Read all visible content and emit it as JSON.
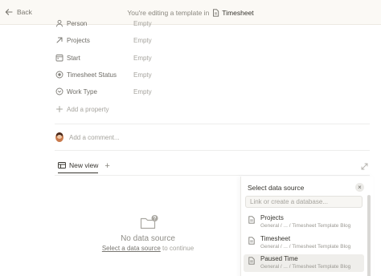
{
  "banner": {
    "back_label": "Back",
    "message": "You're editing a template in",
    "template_name": "Timesheet"
  },
  "properties": [
    {
      "name": "Person",
      "value": "Empty",
      "icon": "person-icon"
    },
    {
      "name": "Projects",
      "value": "Empty",
      "icon": "relation-arrow-icon"
    },
    {
      "name": "Start",
      "value": "Empty",
      "icon": "calendar-icon"
    },
    {
      "name": "Timesheet Status",
      "value": "Empty",
      "icon": "status-icon"
    },
    {
      "name": "Work Type",
      "value": "Empty",
      "icon": "select-icon"
    }
  ],
  "add_property_label": "Add a property",
  "comment": {
    "placeholder": "Add a comment..."
  },
  "view": {
    "tab_label": "New view",
    "add_view": "+"
  },
  "empty_state": {
    "title": "No data source",
    "link_text": "Select a data source",
    "suffix": "to continue"
  },
  "data_source_panel": {
    "title": "Select data source",
    "close": "×",
    "search_placeholder": "Link or create a database...",
    "items": [
      {
        "name": "Projects",
        "path": "General / ... / Timesheet Template Blog"
      },
      {
        "name": "Timesheet",
        "path": "General / ... / Timesheet Template Blog"
      },
      {
        "name": "Paused Time",
        "path": "General / ... / Timesheet Template Blog"
      }
    ]
  }
}
